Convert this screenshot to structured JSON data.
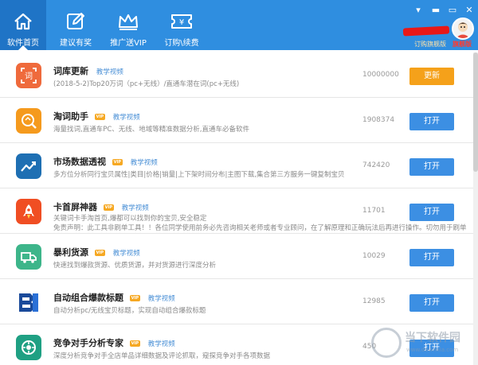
{
  "nav": {
    "tabs": [
      {
        "label": "软件首页",
        "icon": "home-icon",
        "active": true
      },
      {
        "label": "建议有奖",
        "icon": "edit-icon",
        "active": false
      },
      {
        "label": "推广送VIP",
        "icon": "crown-icon",
        "active": false
      },
      {
        "label": "订购\\续费",
        "icon": "ticket-icon",
        "active": false
      }
    ]
  },
  "user": {
    "order_flagship": "订购旗舰版",
    "edition": "旗舰版"
  },
  "colors": {
    "header": "#2f8ee0",
    "button_blue": "#3c8fe3",
    "button_orange": "#f5a11a",
    "vip_badge": "#f6a822",
    "tutorial_link": "#4a90d6"
  },
  "apps": [
    {
      "title": "词库更新",
      "vip": false,
      "tutorial": "教学视频",
      "desc": "(2018-5-2)Top20万词（pc+无线）/直通车潜在词(pc+无线)",
      "desc2": "",
      "count": "10000000",
      "button": "更新",
      "button_style": "orange",
      "icon": "word-library-icon",
      "icon_color": "#ef6a3c"
    },
    {
      "title": "淘词助手",
      "vip": true,
      "tutorial": "教学视频",
      "desc": "海量找词,直通车PC、无线、地域等精准数据分析,直通车必备软件",
      "desc2": "",
      "count": "1908374",
      "button": "打开",
      "button_style": "blue",
      "icon": "search-word-icon",
      "icon_color": "#f59a1d"
    },
    {
      "title": "市场数据透视",
      "vip": true,
      "tutorial": "教学视频",
      "desc": "多方位分析同行宝贝属性|类目|价格|销量|上下架时间分布|主图下载,集合第三方服务一键复制宝贝",
      "desc2": "",
      "count": "742420",
      "button": "打开",
      "button_style": "blue",
      "icon": "trend-chart-icon",
      "icon_color": "#1e6fb3"
    },
    {
      "title": "卡首屏神器",
      "vip": true,
      "tutorial": "教学视频",
      "desc": "关键词卡手淘首页,爆都可以找到你的宝贝,安全稳定",
      "desc2": "免责声明：此工具非刷单工具！！各位同学使用前务必先咨询相关老师或者专业顾问，在了解原理和正确玩法后再进行操作。切勿用于刷单",
      "count": "11701",
      "button": "打开",
      "button_style": "blue",
      "icon": "rocket-icon",
      "icon_color": "#f04e23"
    },
    {
      "title": "暴利货源",
      "vip": true,
      "tutorial": "教学视频",
      "desc": "快速找到爆款货源、优质货源，并对货源进行深度分析",
      "desc2": "",
      "count": "10029",
      "button": "打开",
      "button_style": "blue",
      "icon": "truck-icon",
      "icon_color": "#3db58a"
    },
    {
      "title": "自动组合爆款标题",
      "vip": true,
      "tutorial": "教学视频",
      "desc": "自动分析pc/无线宝贝标题，实现自动组合爆款标题",
      "desc2": "",
      "count": "12985",
      "button": "打开",
      "button_style": "blue",
      "icon": "title-logo-icon",
      "icon_color": "#ffffff"
    },
    {
      "title": "竞争对手分析专家",
      "vip": true,
      "tutorial": "教学视频",
      "desc": "深度分析竞争对手全店单品详细数据及评论抓取，窥探竞争对手各项数据",
      "desc2": "",
      "count": "450",
      "button": "打开",
      "button_style": "blue",
      "icon": "competitor-icon",
      "icon_color": "#1fa083"
    }
  ],
  "watermark": {
    "title": "当下软件园",
    "sub": "www.downxia.com"
  }
}
